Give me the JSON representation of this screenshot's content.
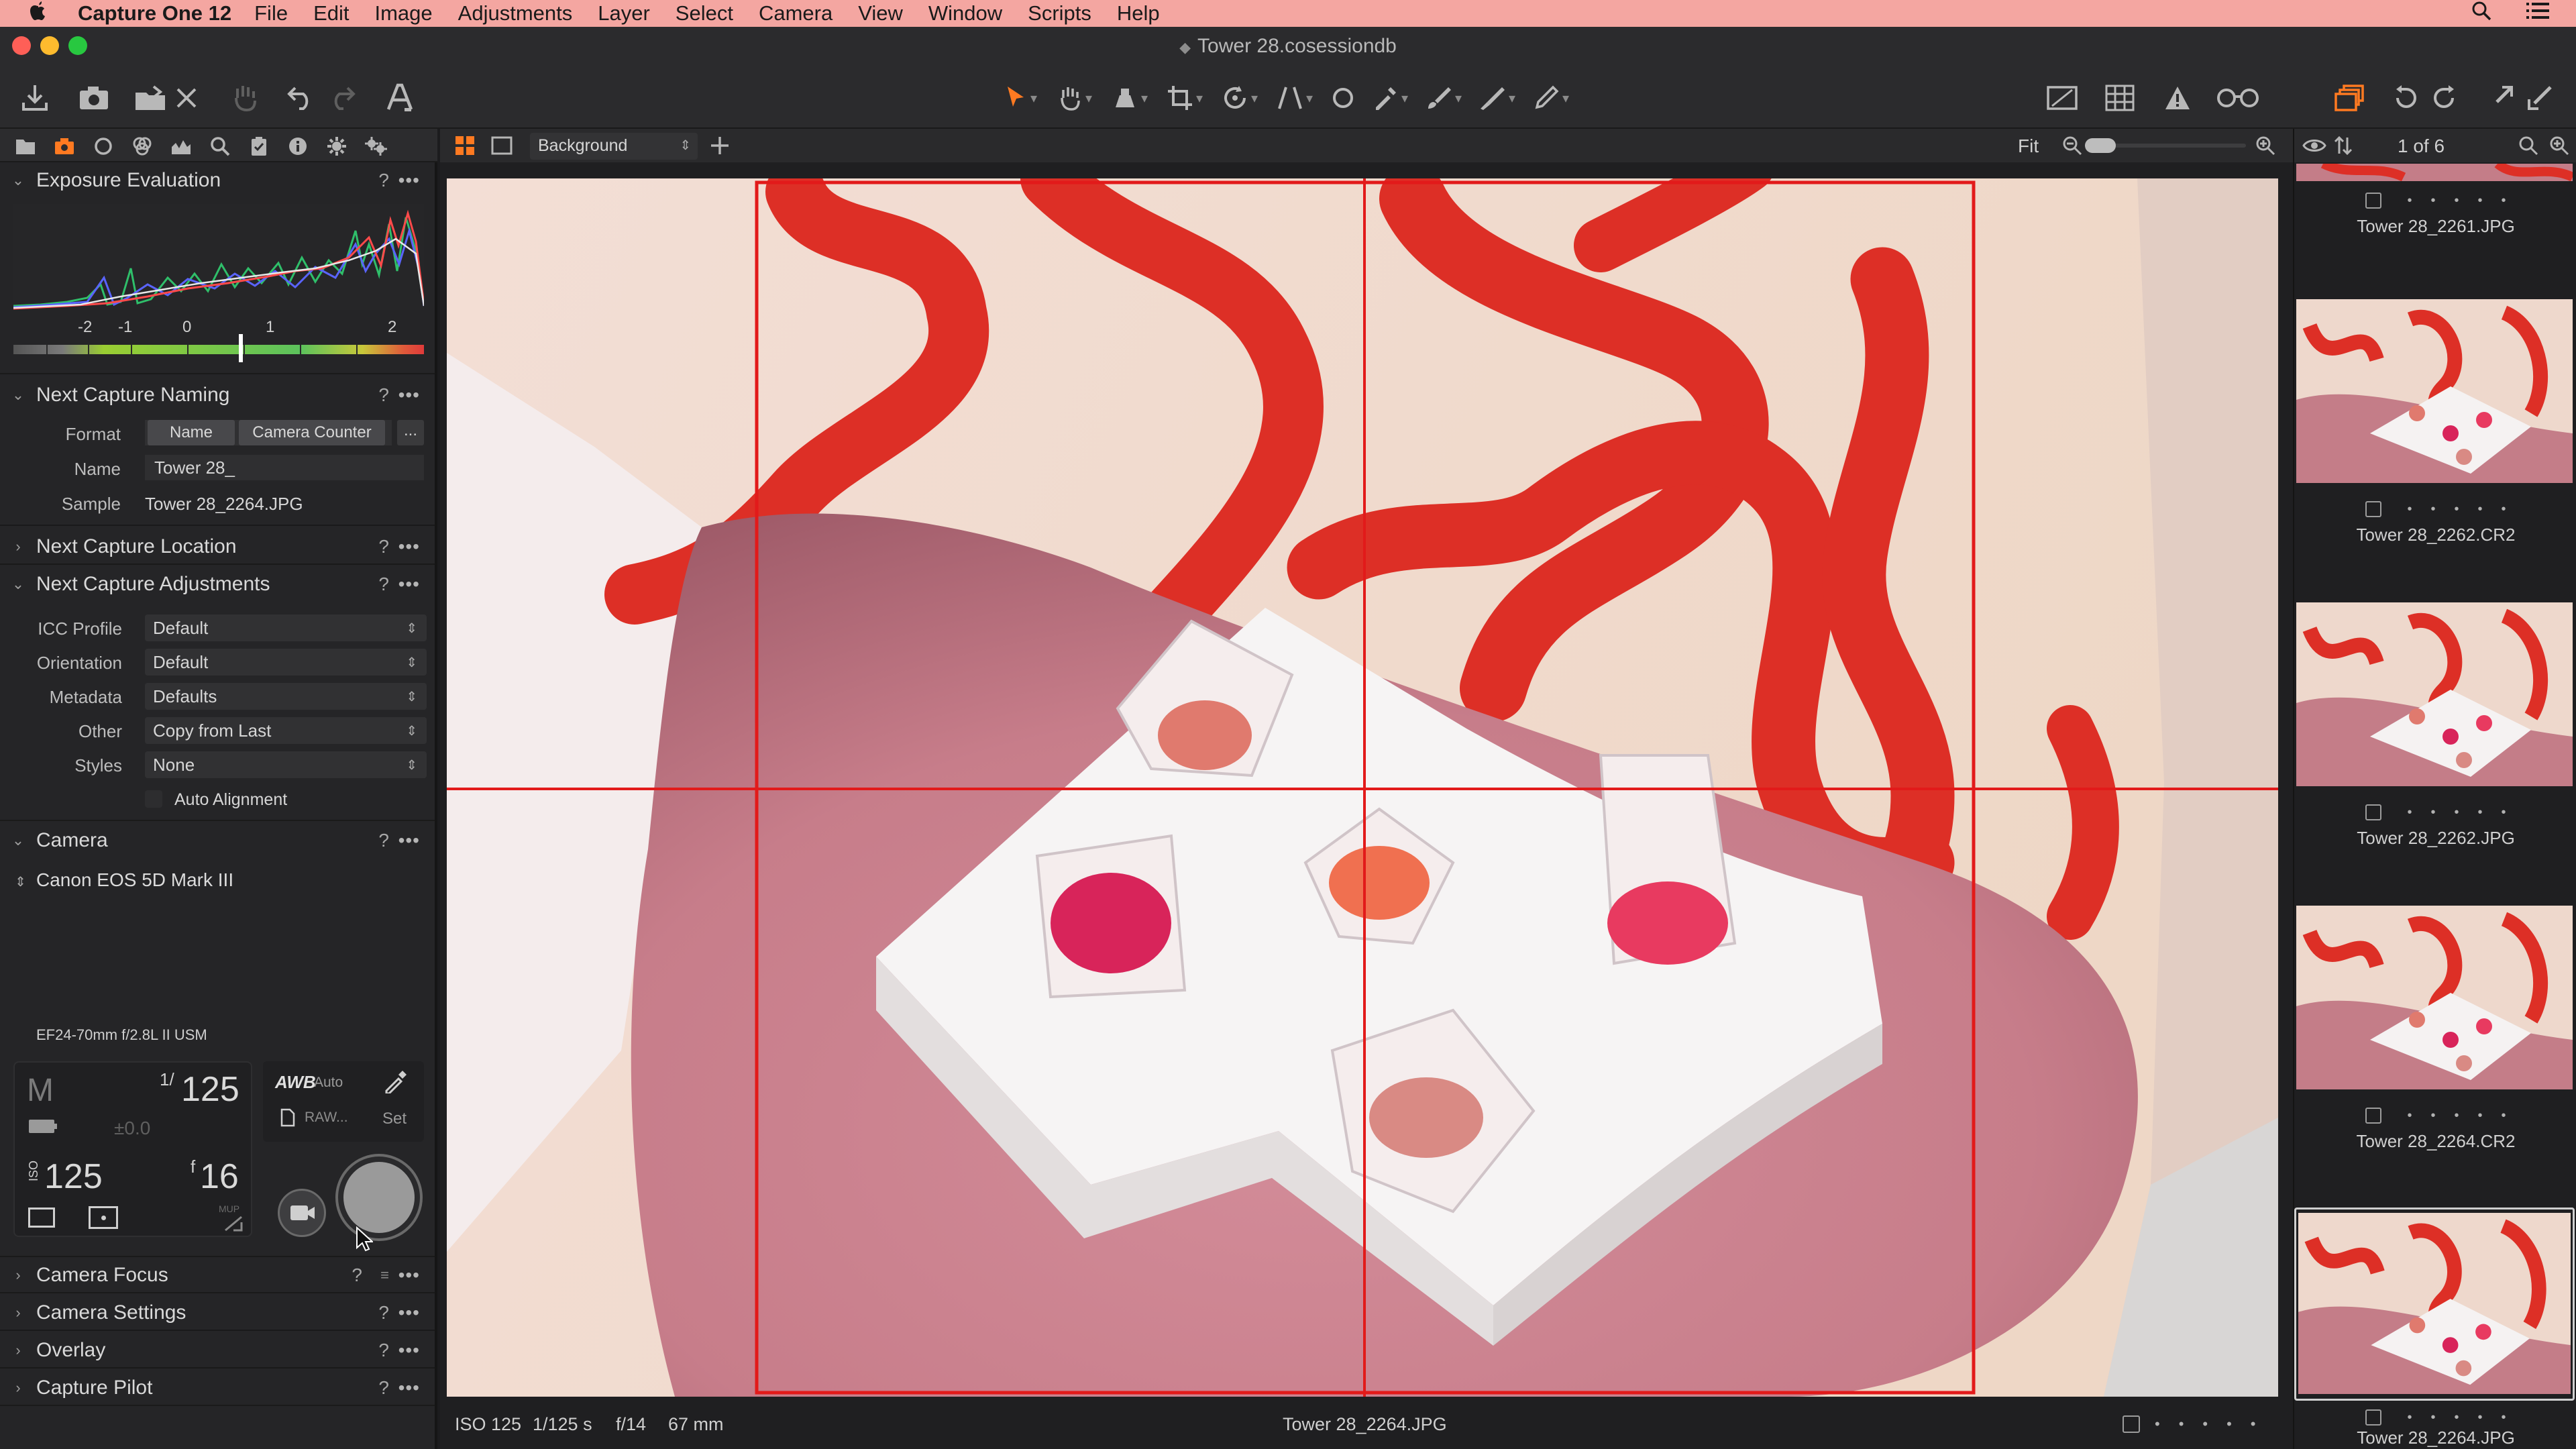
{
  "menubar": {
    "app_name": "Capture One 12",
    "items": [
      "File",
      "Edit",
      "Image",
      "Adjustments",
      "Layer",
      "Select",
      "Camera",
      "View",
      "Window",
      "Scripts",
      "Help"
    ]
  },
  "window": {
    "title": "Tower 28.cosessiondb"
  },
  "viewer": {
    "variant_select": "Background",
    "zoom_label": "Fit",
    "status": {
      "iso": "ISO 125",
      "shutter": "1/125 s",
      "aperture": "f/14",
      "focal": "67 mm",
      "filename": "Tower 28_2264.JPG"
    }
  },
  "browser": {
    "counter": "1 of 6",
    "thumbnails": [
      {
        "name": "Tower 28_2261.JPG"
      },
      {
        "name": "Tower 28_2262.CR2"
      },
      {
        "name": "Tower 28_2262.JPG"
      },
      {
        "name": "Tower 28_2264.CR2"
      },
      {
        "name": "Tower 28_2264.JPG"
      }
    ]
  },
  "panels": {
    "exposure": {
      "title": "Exposure Evaluation",
      "scale_labels": [
        "-2",
        "-1",
        "0",
        "1",
        "2"
      ]
    },
    "naming": {
      "title": "Next Capture Naming",
      "format_label": "Format",
      "format_tokens": [
        "Name",
        "Camera Counter"
      ],
      "more_button": "...",
      "name_label": "Name",
      "name_value": "Tower 28_",
      "sample_label": "Sample",
      "sample_value": "Tower 28_2264.JPG"
    },
    "location": {
      "title": "Next Capture Location"
    },
    "adjustments": {
      "title": "Next Capture Adjustments",
      "rows": [
        {
          "label": "ICC Profile",
          "value": "Default"
        },
        {
          "label": "Orientation",
          "value": "Default"
        },
        {
          "label": "Metadata",
          "value": "Defaults"
        },
        {
          "label": "Other",
          "value": "Copy from Last"
        },
        {
          "label": "Styles",
          "value": "None"
        }
      ],
      "auto_alignment": "Auto Alignment"
    },
    "camera": {
      "title": "Camera",
      "model": "Canon EOS 5D Mark III",
      "lens": "EF24-70mm f/2.8L II USM",
      "mode": "M",
      "shutter_num": "1/",
      "shutter_den": "125",
      "exposure_comp": "±0.0",
      "iso_label": "ISO",
      "iso_value": "125",
      "aperture_prefix": "f",
      "aperture_value": "16",
      "wb_label": "AWB",
      "wb_value": "Auto",
      "format_value": "RAW...",
      "set_label": "Set",
      "mup_label": "MUP"
    },
    "collapsed": [
      {
        "title": "Camera Focus"
      },
      {
        "title": "Camera Settings"
      },
      {
        "title": "Overlay"
      },
      {
        "title": "Capture Pilot"
      }
    ],
    "help_icon": "?",
    "menu_icon": "•••"
  },
  "colors": {
    "menubar_bg": "#f4a6a1",
    "accent": "#ff7a21",
    "overlay_line": "#e21a1a",
    "wall": "#eed8cc",
    "squiggle": "#dd2f26",
    "sand": "#c98791"
  }
}
